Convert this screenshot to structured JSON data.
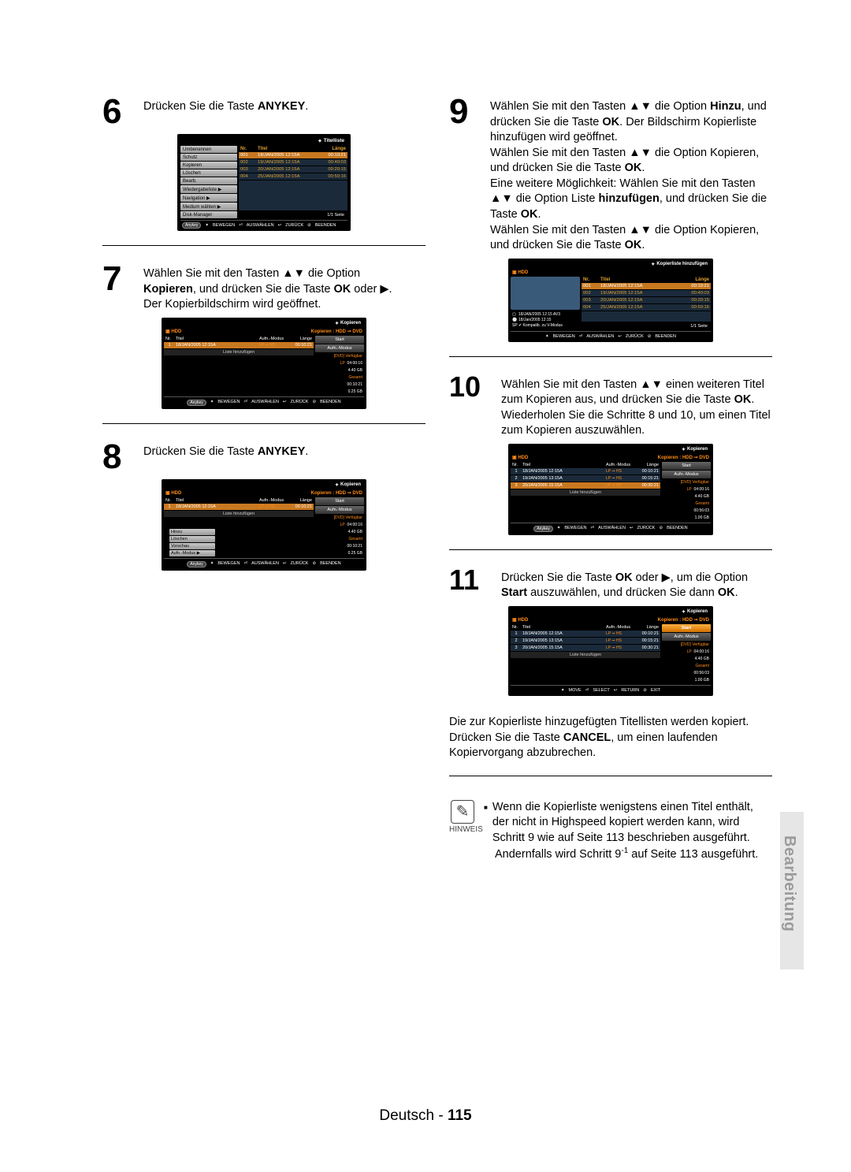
{
  "sideTab": "Bearbeitung",
  "pageFooter": {
    "lang": "Deutsch",
    "sep": " - ",
    "num": "115"
  },
  "steps": {
    "s6": {
      "num": "6",
      "text_pre": "Drücken Sie die Taste ",
      "text_key": "ANYKEY",
      "text_post": "."
    },
    "s7": {
      "num": "7",
      "l1_a": "Wählen Sie mit den Tasten ▲▼ die Option ",
      "l2_a": "Kopieren",
      "l2_b": ", und drücken Sie die Taste ",
      "l2_c": "OK",
      "l2_d": " oder ▶.",
      "l3": "Der Kopierbildschirm wird geöffnet."
    },
    "s8": {
      "num": "8",
      "text_pre": "Drücken Sie die Taste ",
      "text_key": "ANYKEY",
      "text_post": "."
    },
    "s9": {
      "num": "9",
      "p1_a": "Wählen Sie mit den Tasten ▲▼ die Option ",
      "p1_b": "Hinzu",
      "p1_c": ", und drücken Sie die Taste ",
      "p1_d": "OK",
      "p1_e": ". Der Bildschirm Kopierliste hinzufügen wird geöffnet.",
      "p2_a": "Wählen Sie mit den Tasten ▲▼ die Option Kopieren, und drücken Sie die Taste ",
      "p2_b": "OK",
      "p2_c": ".",
      "p3_a": "Eine weitere Möglichkeit: Wählen Sie mit den Tasten ▲▼ die Option Liste ",
      "p3_b": "hinzufügen",
      "p3_c": ", und drücken Sie die Taste ",
      "p3_d": "OK",
      "p3_e": ".",
      "p4_a": "Wählen Sie mit den Tasten ▲▼ die Option Kopieren, und drücken Sie die Taste ",
      "p4_b": "OK",
      "p4_c": "."
    },
    "s10": {
      "num": "10",
      "a": "Wählen Sie mit den Tasten ▲▼ einen weiteren Titel zum Kopieren aus, und drücken Sie die Taste ",
      "b": "OK",
      "c": ". Wiederholen Sie die Schritte 8 und 10, um einen Titel zum Kopieren auszuwählen."
    },
    "s11": {
      "num": "11",
      "a": "Drücken Sie die Taste ",
      "b": "OK",
      "c": " oder ▶, um die Option ",
      "d": "Start",
      "e": " auszuwählen, und drücken Sie dann ",
      "f": "OK",
      "g": "."
    }
  },
  "afterText": {
    "l1": "Die zur Kopierliste hinzugefügten Titellisten werden kopiert. Drücken Sie die Taste ",
    "l1b": "CANCEL",
    "l1c": ", um einen laufenden Kopiervorgang abzubrechen."
  },
  "note": {
    "label": "HINWEIS",
    "t1": "Wenn die Kopierliste wenigstens einen Titel enthält, der nicht in Highspeed kopiert werden kann, wird Schritt 9 wie auf Seite 113 beschrieben ausgeführt.",
    "t2a": "Andernfalls wird Schritt 9",
    "t2sup": "-1",
    "t2b": " auf Seite 113 ausgeführt."
  },
  "ui": {
    "titlelist": "Titelliste",
    "kopieren": "Kopieren",
    "kopierHeader": "Kopieren : HDD ➞ DVD",
    "kopierAdd": "Kopierliste hinzufügen",
    "hdd": "HDD",
    "cols": {
      "nr": "Nr.",
      "titel": "Titel",
      "laenge": "Länge",
      "aufn": "Aufn.-Modus"
    },
    "pageInd": "1/1 Seite",
    "footer": {
      "move": "BEWEGEN",
      "select": "AUSWÄHLEN",
      "return": "ZURÜCK",
      "exit": "BEENDEN",
      "moveE": "MOVE",
      "selectE": "SELECT",
      "returnE": "RETURN",
      "exitE": "EXIT",
      "anykey": "Anykey"
    },
    "listeHinzu": "Liste hinzufügen",
    "side9": {
      "d1": "18/JAN/2005 12:15 AV3",
      "d2": "18/Jan/2005 12:15",
      "d3": "SP ✔ Kompatib. zu V-Modus"
    },
    "buttons": {
      "start": "Start",
      "aufn": "Aufn.-Modus"
    },
    "stats": {
      "dvdVerf": "[DVD] Verfügbar",
      "lp": "LP",
      "lpV": "04:00:16",
      "sz": "4.40 GB",
      "gesamt": "Gesamt",
      "gV7": "00:10:21",
      "gS7": "0.25 GB",
      "gV10": "00:56:03",
      "gS10": "1.00 GB",
      "gV11": "00:56:03",
      "gS11": "1.00 GB"
    }
  },
  "rows6": [
    {
      "n": "001",
      "t": "18/JAN/2005 12:15A",
      "l": "00:10:21",
      "hl": true
    },
    {
      "n": "002",
      "t": "19/JAN/2005 12:15A",
      "l": "00:40:03"
    },
    {
      "n": "003",
      "t": "20/JAN/2005 12:15A",
      "l": "00:20:15"
    },
    {
      "n": "004",
      "t": "25/JAN/2005 12:15A",
      "l": "00:50:16"
    }
  ],
  "side6": [
    "Umbenennen",
    "Schutz",
    "Kopieren",
    "Löschen",
    "Bearb.",
    "Wiedergabeliste  ▶",
    "Navigation            ▶",
    "Medium wählen   ▶",
    "Disk-Manager"
  ],
  "rows7": [
    {
      "n": "1",
      "t": "18/JAN/2005 12:15A",
      "m": "LP ➞ HS",
      "l": "00:10:21",
      "hl": true
    }
  ],
  "rows8": [
    {
      "n": "1",
      "t": "18/JAN/2005 12:15A",
      "m": "LP ➞ HS",
      "l": "00:10:21",
      "hl": true
    }
  ],
  "popup8": [
    "Hinzu",
    "Löschen",
    "Vorschau",
    "Aufn.-Modus     ▶"
  ],
  "rows9": [
    {
      "n": "001",
      "t": "18/JAN/2005 12:15A",
      "l": "00:10:21",
      "hl": true
    },
    {
      "n": "002",
      "t": "19/JAN/2005 12:15A",
      "l": "00:40:03"
    },
    {
      "n": "003",
      "t": "20/JAN/2005 12:15A",
      "l": "00:20:15"
    },
    {
      "n": "004",
      "t": "25/JAN/2005 12:15A",
      "l": "00:50:16"
    }
  ],
  "rows10": [
    {
      "n": "1",
      "t": "18/JAN/2005 12:15A",
      "m": "LP ➞ HS",
      "l": "00:10:21"
    },
    {
      "n": "2",
      "t": "19/JAN/2005 13:15A",
      "m": "LP ➞ HS",
      "l": "00:15:21"
    },
    {
      "n": "3",
      "t": "20/JAN/2005 15:15A",
      "m": "LP ➞ HS",
      "l": "00:30:21",
      "hl": true
    }
  ],
  "rows11": [
    {
      "n": "1",
      "t": "18/JAN/2005 12:15A",
      "m": "LP ➞ HS",
      "l": "00:10:21"
    },
    {
      "n": "2",
      "t": "19/JAN/2005 13:15A",
      "m": "LP ➞ HS",
      "l": "00:15:21"
    },
    {
      "n": "3",
      "t": "20/JAN/2005 15:15A",
      "m": "LP ➞ HS",
      "l": "00:30:21"
    }
  ]
}
